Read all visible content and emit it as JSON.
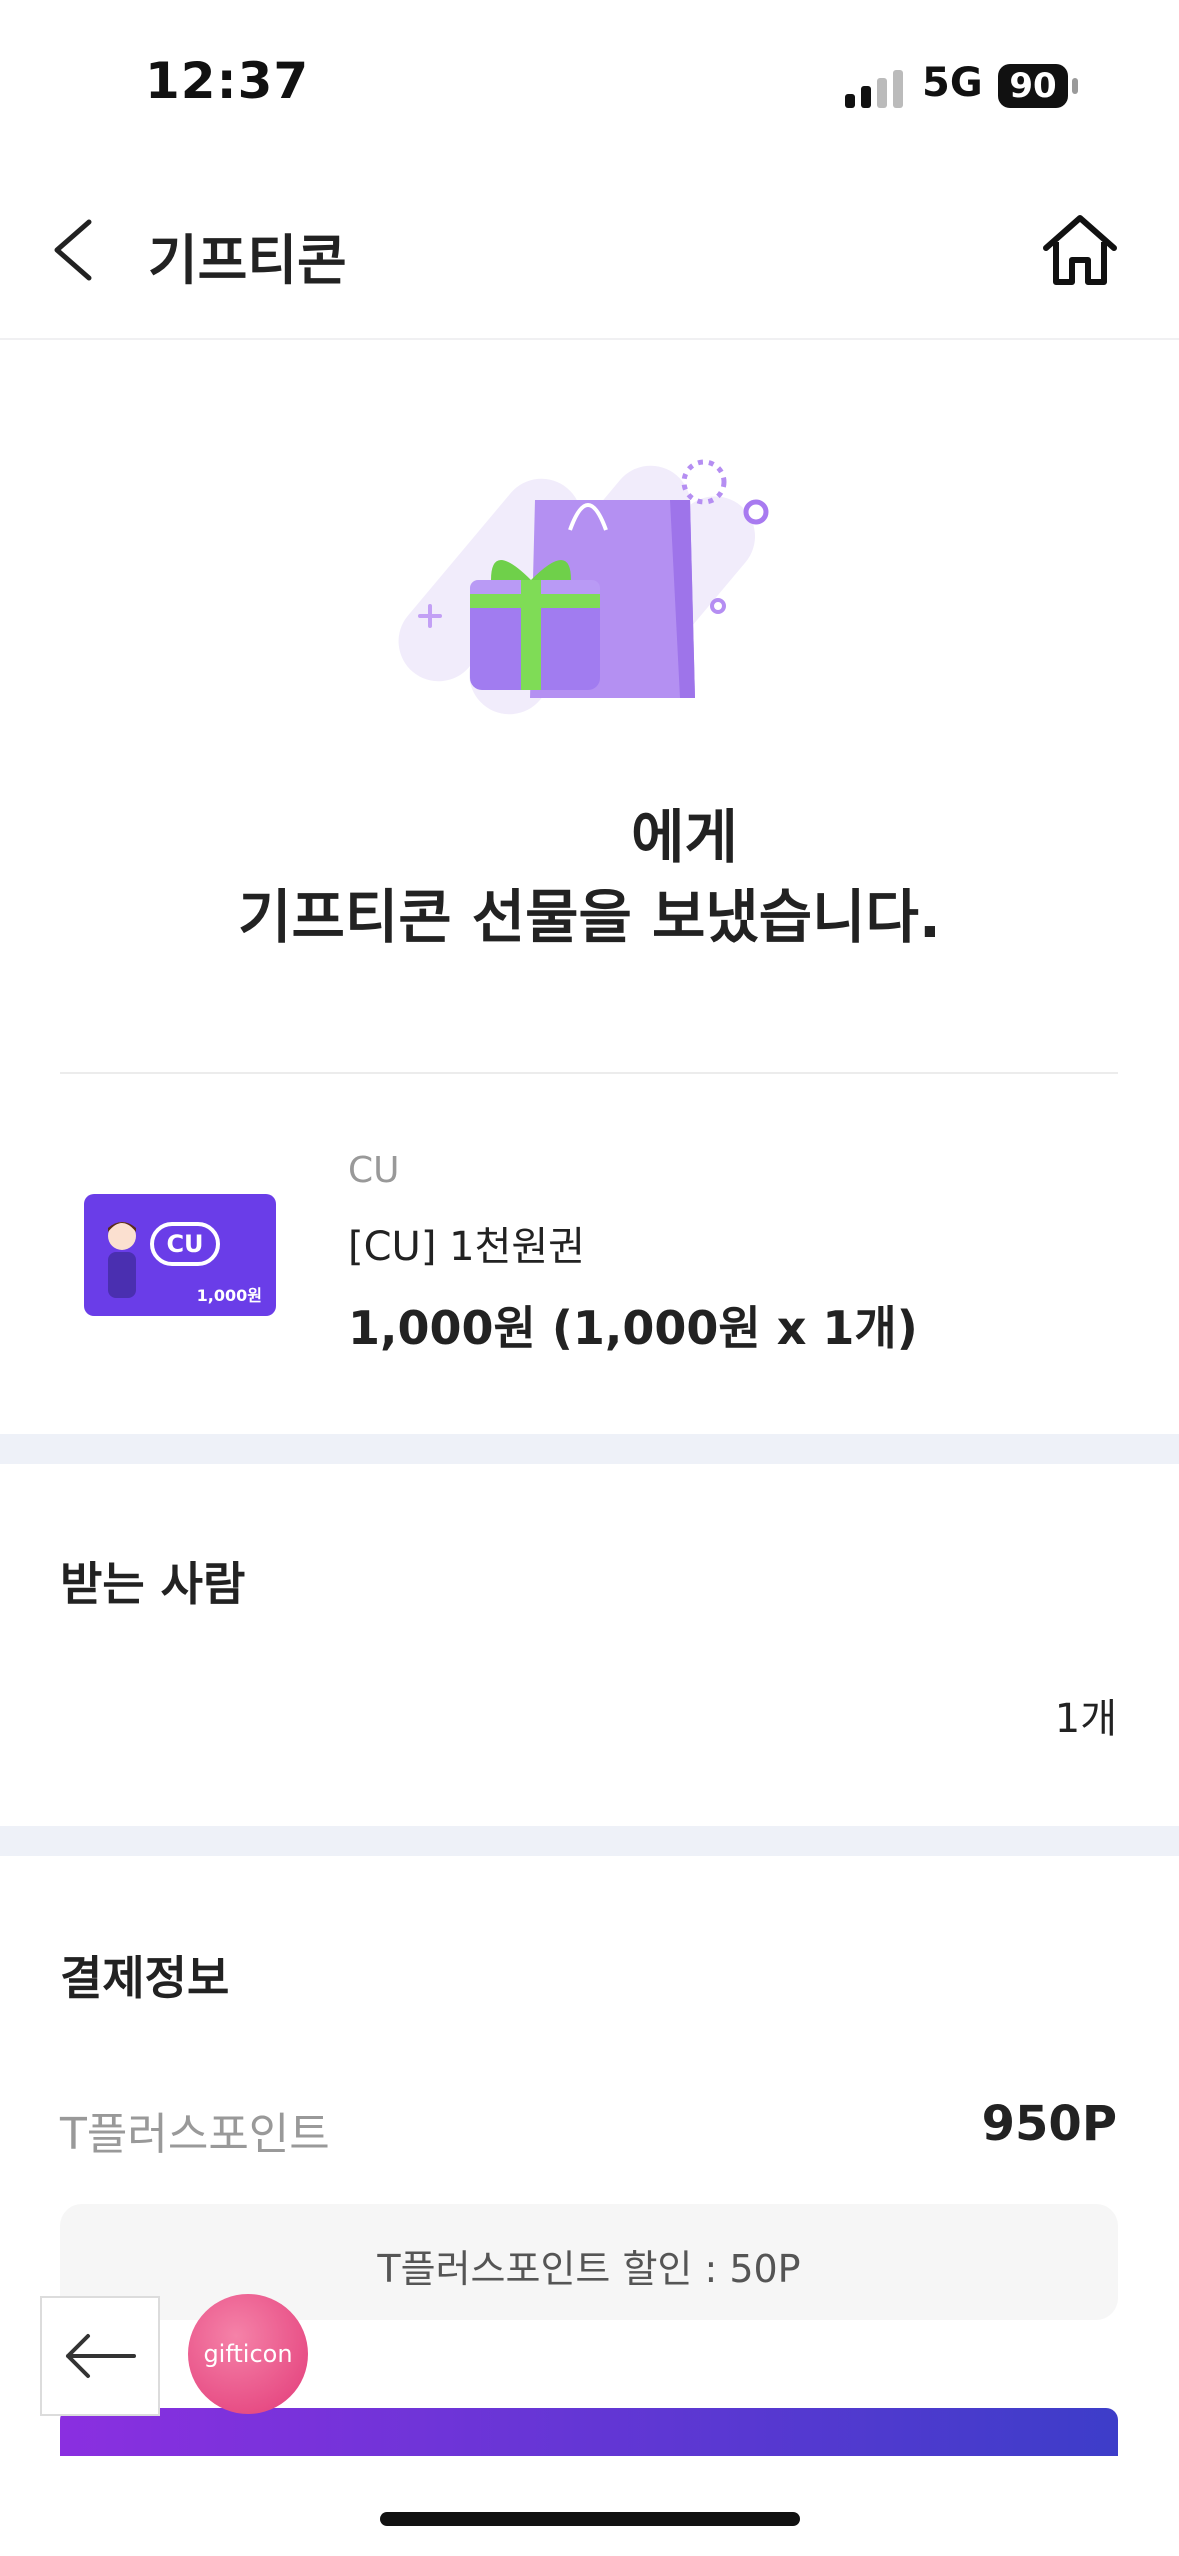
{
  "status_bar": {
    "time": "12:37",
    "network": "5G",
    "battery": "90"
  },
  "header": {
    "title": "기프티콘"
  },
  "message": {
    "line1": "에게",
    "line2": "기프티콘 선물을 보냈습니다."
  },
  "product": {
    "brand": "CU",
    "name": "[CU] 1천원권",
    "price": "1,000원 (1,000원 x 1개)",
    "card_logo": "CU",
    "card_amount": "1,000원"
  },
  "recipient": {
    "title": "받는 사람",
    "count": "1개"
  },
  "payment": {
    "title": "결제정보",
    "label": "T플러스포인트",
    "value": "950P",
    "discount": "T플러스포인트 할인 : 50P"
  },
  "floating": {
    "bubble_label": "gifticon"
  },
  "colors": {
    "accent": "#8a2fe0",
    "band": "#eef1f8",
    "bubble": "#e23a78"
  }
}
